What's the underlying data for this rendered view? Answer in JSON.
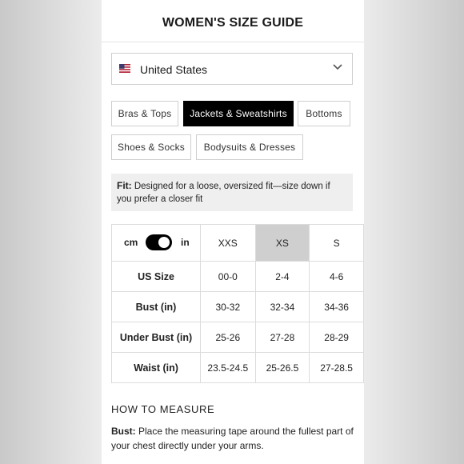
{
  "header": {
    "title": "WOMEN'S SIZE GUIDE"
  },
  "country": {
    "flag_icon": "us-flag-icon",
    "name": "United States",
    "chevron_icon": "chevron-down-icon"
  },
  "tabs": [
    {
      "label": "Bras & Tops",
      "active": false
    },
    {
      "label": "Jackets & Sweatshirts",
      "active": true
    },
    {
      "label": "Bottoms",
      "active": false
    },
    {
      "label": "Shoes & Socks",
      "active": false
    },
    {
      "label": "Bodysuits & Dresses",
      "active": false
    }
  ],
  "fit": {
    "label": "Fit:",
    "text": "Designed for a loose, oversized fit—size down if you prefer a closer fit"
  },
  "units": {
    "cm": "cm",
    "in": "in",
    "toggle_state": "in"
  },
  "table": {
    "columns": [
      "XXS",
      "XS",
      "S"
    ],
    "selected_column": "XS",
    "rows": [
      {
        "label": "US Size",
        "values": [
          "00-0",
          "2-4",
          "4-6"
        ]
      },
      {
        "label": "Bust (in)",
        "values": [
          "30-32",
          "32-34",
          "34-36"
        ]
      },
      {
        "label": "Under Bust (in)",
        "values": [
          "25-26",
          "27-28",
          "28-29"
        ]
      },
      {
        "label": "Waist (in)",
        "values": [
          "23.5-24.5",
          "25-26.5",
          "27-28.5"
        ]
      }
    ]
  },
  "measure": {
    "heading": "HOW TO MEASURE",
    "bust_label": "Bust:",
    "bust_text": "Place the measuring tape around the fullest part of your chest directly under your arms."
  },
  "colors": {
    "accent": "#000000",
    "selected_column": "#cfcfcf",
    "fit_background": "#efefef"
  }
}
